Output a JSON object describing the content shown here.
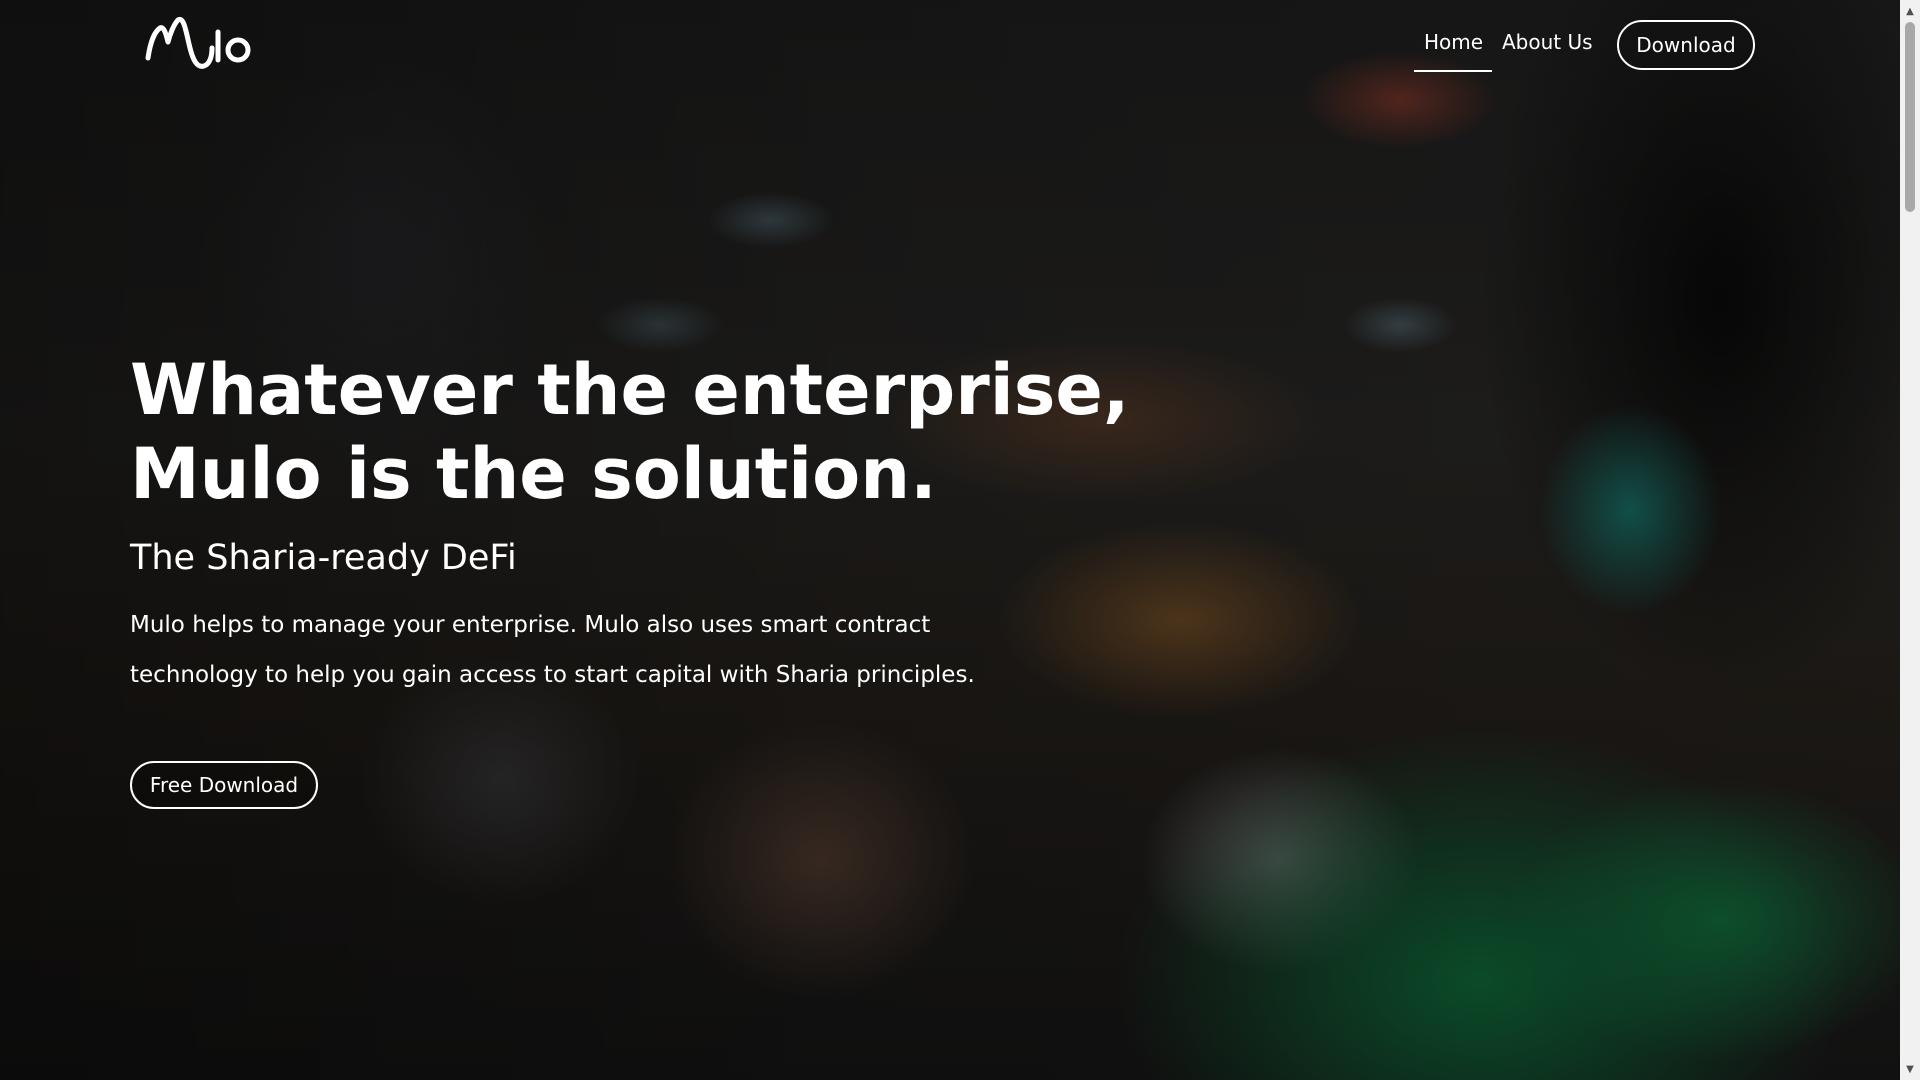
{
  "brand": {
    "logo_text": "Mulo"
  },
  "nav": {
    "home_label": "Home",
    "about_label": "About Us",
    "download_label": "Download",
    "active": "Home"
  },
  "hero": {
    "title_line1": "Whatever the enterprise,",
    "title_line2": "Mulo is the solution.",
    "subtitle": "The Sharia-ready DeFi",
    "description": "Mulo helps to manage your enterprise. Mulo also uses smart contract technology to help you gain access to start capital with Sharia principles.",
    "cta_label": "Free Download"
  },
  "icons": {
    "scroll_up": "scroll-up-arrow-icon",
    "scroll_down": "scroll-down-arrow-icon"
  },
  "colors": {
    "text": "#ffffff",
    "overlay": "#000000",
    "accent_green": "#0c6034"
  }
}
